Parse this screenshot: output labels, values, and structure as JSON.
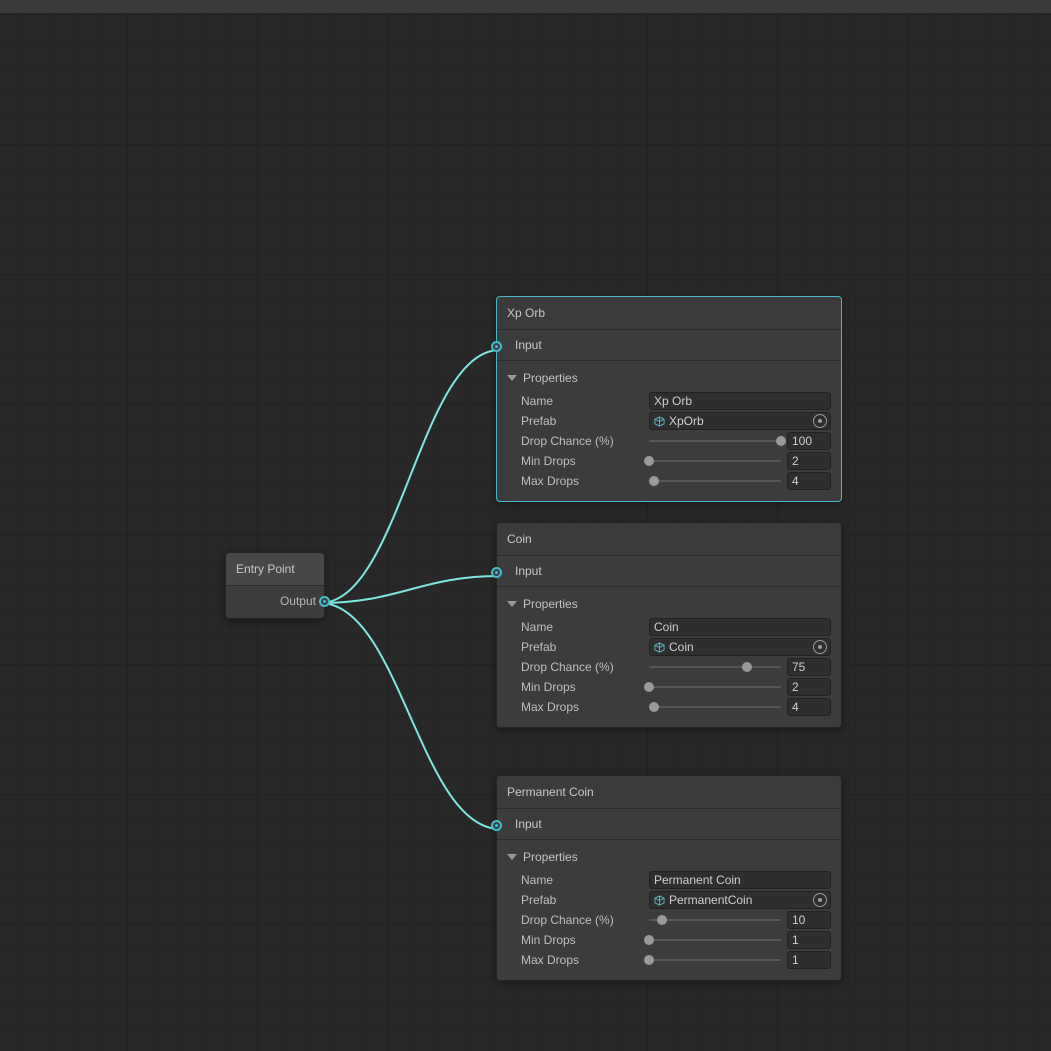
{
  "entry": {
    "title": "Entry Point",
    "output_label": "Output"
  },
  "input_label": "Input",
  "properties_label": "Properties",
  "labels": {
    "name": "Name",
    "prefab": "Prefab",
    "drop_chance": "Drop Chance (%)",
    "min_drops": "Min Drops",
    "max_drops": "Max Drops"
  },
  "nodes": [
    {
      "title": "Xp Orb",
      "name": "Xp Orb",
      "prefab": "XpOrb",
      "drop_chance": 100,
      "min_drops": 2,
      "max_drops": 4,
      "drop_chance_pct": "100%",
      "min_pct": "0%",
      "max_pct": "4%"
    },
    {
      "title": "Coin",
      "name": "Coin",
      "prefab": "Coin",
      "drop_chance": 75,
      "min_drops": 2,
      "max_drops": 4,
      "drop_chance_pct": "74%",
      "min_pct": "0%",
      "max_pct": "4%"
    },
    {
      "title": "Permanent Coin",
      "name": "Permanent Coin",
      "prefab": "PermanentCoin",
      "drop_chance": 10,
      "min_drops": 1,
      "max_drops": 1,
      "drop_chance_pct": "10%",
      "min_pct": "0%",
      "max_pct": "0%"
    }
  ]
}
